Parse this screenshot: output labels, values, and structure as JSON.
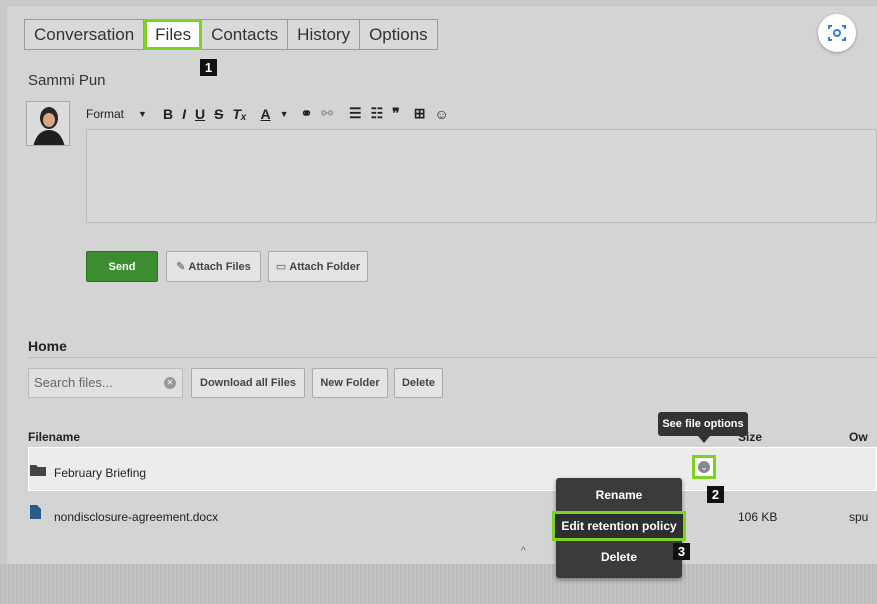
{
  "tabs": [
    {
      "label": "Conversation",
      "active": false
    },
    {
      "label": "Files",
      "active": true
    },
    {
      "label": "Contacts",
      "active": false
    },
    {
      "label": "History",
      "active": false
    },
    {
      "label": "Options",
      "active": false
    }
  ],
  "annotations": [
    "1",
    "2",
    "3"
  ],
  "compose": {
    "contact_name": "Sammi Pun",
    "format_label": "Format",
    "send_label": "Send",
    "attach_files_label": "Attach Files",
    "attach_folder_label": "Attach Folder"
  },
  "files": {
    "title": "Home",
    "search_placeholder": "Search files...",
    "download_all_label": "Download all Files",
    "new_folder_label": "New Folder",
    "delete_label": "Delete",
    "columns": {
      "filename": "Filename",
      "size": "Size",
      "owner": "Ow"
    },
    "rows": [
      {
        "name": "February Briefing",
        "type": "folder",
        "size": "",
        "owner": ""
      },
      {
        "name": "nondisclosure-agreement.docx",
        "type": "file",
        "size": "106 KB",
        "owner": "spu"
      }
    ],
    "tooltip": "See file options"
  },
  "context_menu": {
    "items": [
      "Rename",
      "Edit retention policy",
      "Delete"
    ]
  },
  "colors": {
    "highlight": "#7ed321",
    "send_button": "#3c8d2f",
    "menu_bg": "#3b3b3b"
  }
}
